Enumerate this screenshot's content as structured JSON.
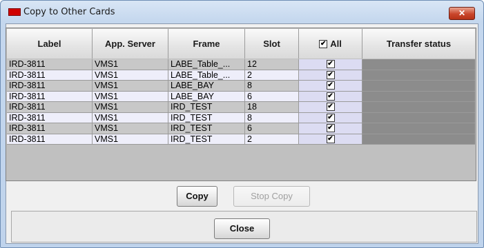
{
  "window": {
    "title": "Copy to Other Cards",
    "close_glyph": "✕"
  },
  "table": {
    "columns": {
      "label": "Label",
      "server": "App. Server",
      "frame": "Frame",
      "slot": "Slot",
      "all": "All",
      "status": "Transfer status"
    },
    "all_checked": true,
    "rows": [
      {
        "label": "IRD-3811",
        "server": "VMS1",
        "frame": "LABE_Table_...",
        "slot": "12",
        "checked": true
      },
      {
        "label": "IRD-3811",
        "server": "VMS1",
        "frame": "LABE_Table_...",
        "slot": "2",
        "checked": true
      },
      {
        "label": "IRD-3811",
        "server": "VMS1",
        "frame": "LABE_BAY",
        "slot": "8",
        "checked": true
      },
      {
        "label": "IRD-3811",
        "server": "VMS1",
        "frame": "LABE_BAY",
        "slot": "6",
        "checked": true
      },
      {
        "label": "IRD-3811",
        "server": "VMS1",
        "frame": "IRD_TEST",
        "slot": "18",
        "checked": true
      },
      {
        "label": "IRD-3811",
        "server": "VMS1",
        "frame": "IRD_TEST",
        "slot": "8",
        "checked": true
      },
      {
        "label": "IRD-3811",
        "server": "VMS1",
        "frame": "IRD_TEST",
        "slot": "6",
        "checked": true
      },
      {
        "label": "IRD-3811",
        "server": "VMS1",
        "frame": "IRD_TEST",
        "slot": "2",
        "checked": true
      }
    ]
  },
  "buttons": {
    "copy": "Copy",
    "stop_copy": "Stop Copy",
    "close": "Close"
  },
  "colors": {
    "title_icon": "#d00000",
    "status_cell": "#8c8c8c",
    "checkbox_cell": "#dcdcf2"
  }
}
